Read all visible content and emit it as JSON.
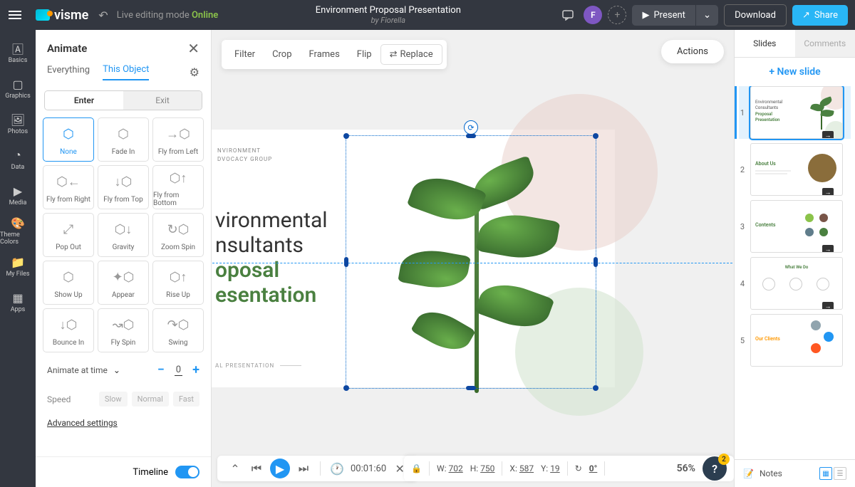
{
  "topbar": {
    "logo_text": "visme",
    "editing_mode": "Live editing mode",
    "online": "Online",
    "title": "Environment Proposal Presentation",
    "author": "by Fiorella",
    "avatar_initial": "F",
    "present": "Present",
    "download": "Download",
    "share": "Share"
  },
  "leftbar": {
    "items": [
      "Basics",
      "Graphics",
      "Photos",
      "Data",
      "Media",
      "Theme Colors",
      "My Files",
      "Apps"
    ]
  },
  "animate": {
    "title": "Animate",
    "tabs": {
      "everything": "Everything",
      "this_object": "This Object"
    },
    "enter": "Enter",
    "exit": "Exit",
    "items": [
      "None",
      "Fade In",
      "Fly from Left",
      "Fly from Right",
      "Fly from Top",
      "Fly from Bottom",
      "Pop Out",
      "Gravity",
      "Zoom Spin",
      "Show Up",
      "Appear",
      "Rise Up",
      "Bounce In",
      "Fly Spin",
      "Swing"
    ],
    "animate_at_time": "Animate at time",
    "time_value": "0",
    "speed_label": "Speed",
    "speeds": [
      "Slow",
      "Normal",
      "Fast"
    ],
    "advanced": "Advanced settings",
    "timeline": "Timeline"
  },
  "canvas": {
    "toolbar": [
      "Filter",
      "Crop",
      "Frames",
      "Flip",
      "Replace"
    ],
    "actions": "Actions",
    "slide": {
      "org_line1": "NVIRONMENT",
      "org_line2": "DVOCACY GROUP",
      "title1": "vironmental",
      "title2": "nsultants",
      "title3": "oposal",
      "title4": "esentation",
      "footer": "AL PRESENTATION"
    }
  },
  "playback": {
    "time": "00:01:60"
  },
  "status": {
    "w_label": "W:",
    "w": "702",
    "h_label": "H:",
    "h": "750",
    "x_label": "X:",
    "x": "587",
    "y_label": "Y:",
    "y": "19",
    "angle": "0°",
    "zoom": "56%",
    "help_badge": "2"
  },
  "right": {
    "tabs": {
      "slides": "Slides",
      "comments": "Comments"
    },
    "new_slide": "+ New slide",
    "notes": "Notes",
    "slides": [
      "1",
      "2",
      "3",
      "4",
      "5"
    ],
    "thumb1": {
      "l1": "Environmental",
      "l2": "Consultants",
      "l3": "Proposal",
      "l4": "Presentation"
    },
    "thumb2": "About Us",
    "thumb3": "Contents",
    "thumb4": "What We Do",
    "thumb5": "Our Clients"
  }
}
